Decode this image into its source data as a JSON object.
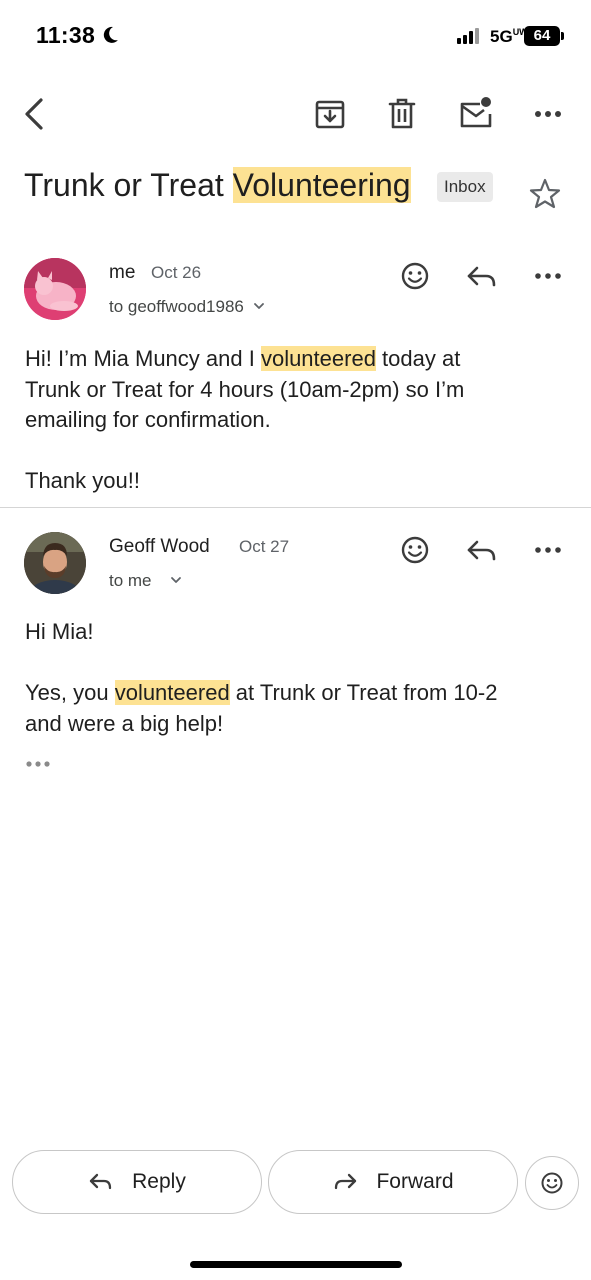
{
  "status_bar": {
    "time": "11:38",
    "network": "5G",
    "network_sup": "UW",
    "battery": "64"
  },
  "toolbar": {
    "back_icon": "chevron-left-icon",
    "archive_icon": "archive-icon",
    "delete_icon": "trash-icon",
    "unread_icon": "mark-unread-icon",
    "more_icon": "more-horizontal-icon"
  },
  "subject": {
    "pre": "Trunk or Treat ",
    "highlight": "Volunteering",
    "label": "Inbox"
  },
  "messages": [
    {
      "sender": "me",
      "date": "Oct 26",
      "to": "to geoffwood1986",
      "body": {
        "l1_pre": "Hi! I’m Mia Muncy and I ",
        "l1_hl": "volunteered",
        "l1_post": " today at",
        "l2": "Trunk or Treat for 4 hours (10am-2pm) so I’m",
        "l3": "emailing for confirmation.",
        "l4": "Thank you!!"
      }
    },
    {
      "sender": "Geoff Wood",
      "date": "Oct 27",
      "to": "to me",
      "body": {
        "l1": "Hi Mia!",
        "l2_pre": "Yes, you ",
        "l2_hl": "volunteered",
        "l2_post": " at Trunk or Treat from 10-2",
        "l3": "and were a big help!"
      }
    }
  ],
  "actions": {
    "reply": "Reply",
    "forward": "Forward"
  },
  "colors": {
    "highlight": "#fde293",
    "text": "#1f1f1f",
    "muted": "#5f6368"
  }
}
